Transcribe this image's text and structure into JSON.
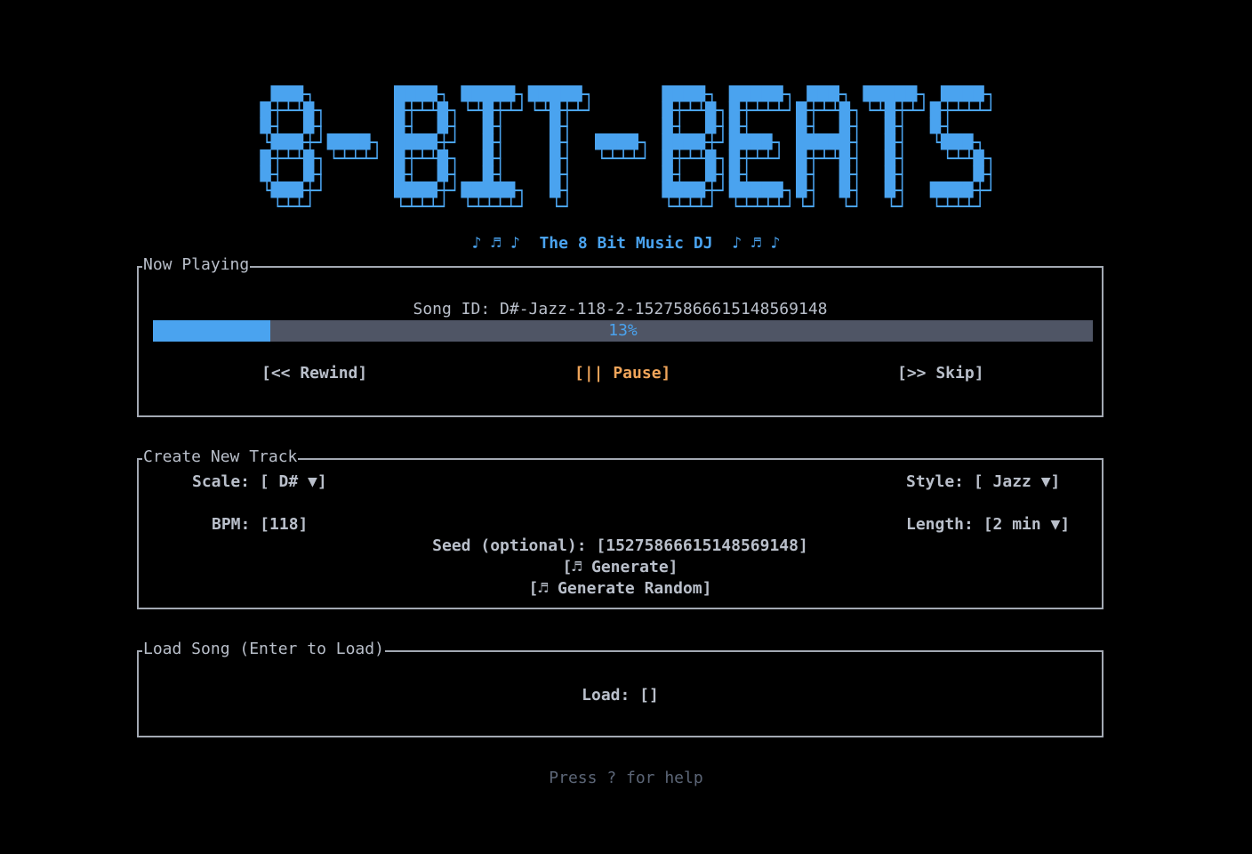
{
  "app": {
    "logo_text": "8-BIT-BEATS",
    "tagline": "♪ ♬ ♪  The 8 Bit Music DJ  ♪ ♬ ♪"
  },
  "colors": {
    "accent": "#4aa3ef",
    "active_control": "#f0a55a",
    "border": "#a3a9b3",
    "progress_track": "#4f5565",
    "muted": "#5c6677"
  },
  "now_playing": {
    "title": "Now Playing",
    "song_id": "Song ID: D#-Jazz-118-2-15275866615148569148",
    "progress_fraction": 0.125,
    "progress_label": "13%",
    "controls": {
      "rewind": "[<< Rewind]",
      "pause": "[|| Pause]",
      "skip": "[>> Skip]"
    }
  },
  "create_track": {
    "title": "Create New Track",
    "scale": "Scale: [ D# ▼]",
    "style": "Style: [ Jazz ▼]",
    "bpm": "BPM: [118]",
    "length": "Length: [2 min ▼]",
    "seed": "Seed (optional): [15275866615148569148]",
    "generate": "[♬ Generate]",
    "generate_random": "[♬ Generate Random]"
  },
  "load_song": {
    "title": "Load Song (Enter to Load)",
    "load": "Load: []"
  },
  "footer": {
    "help": "Press ? for help"
  }
}
